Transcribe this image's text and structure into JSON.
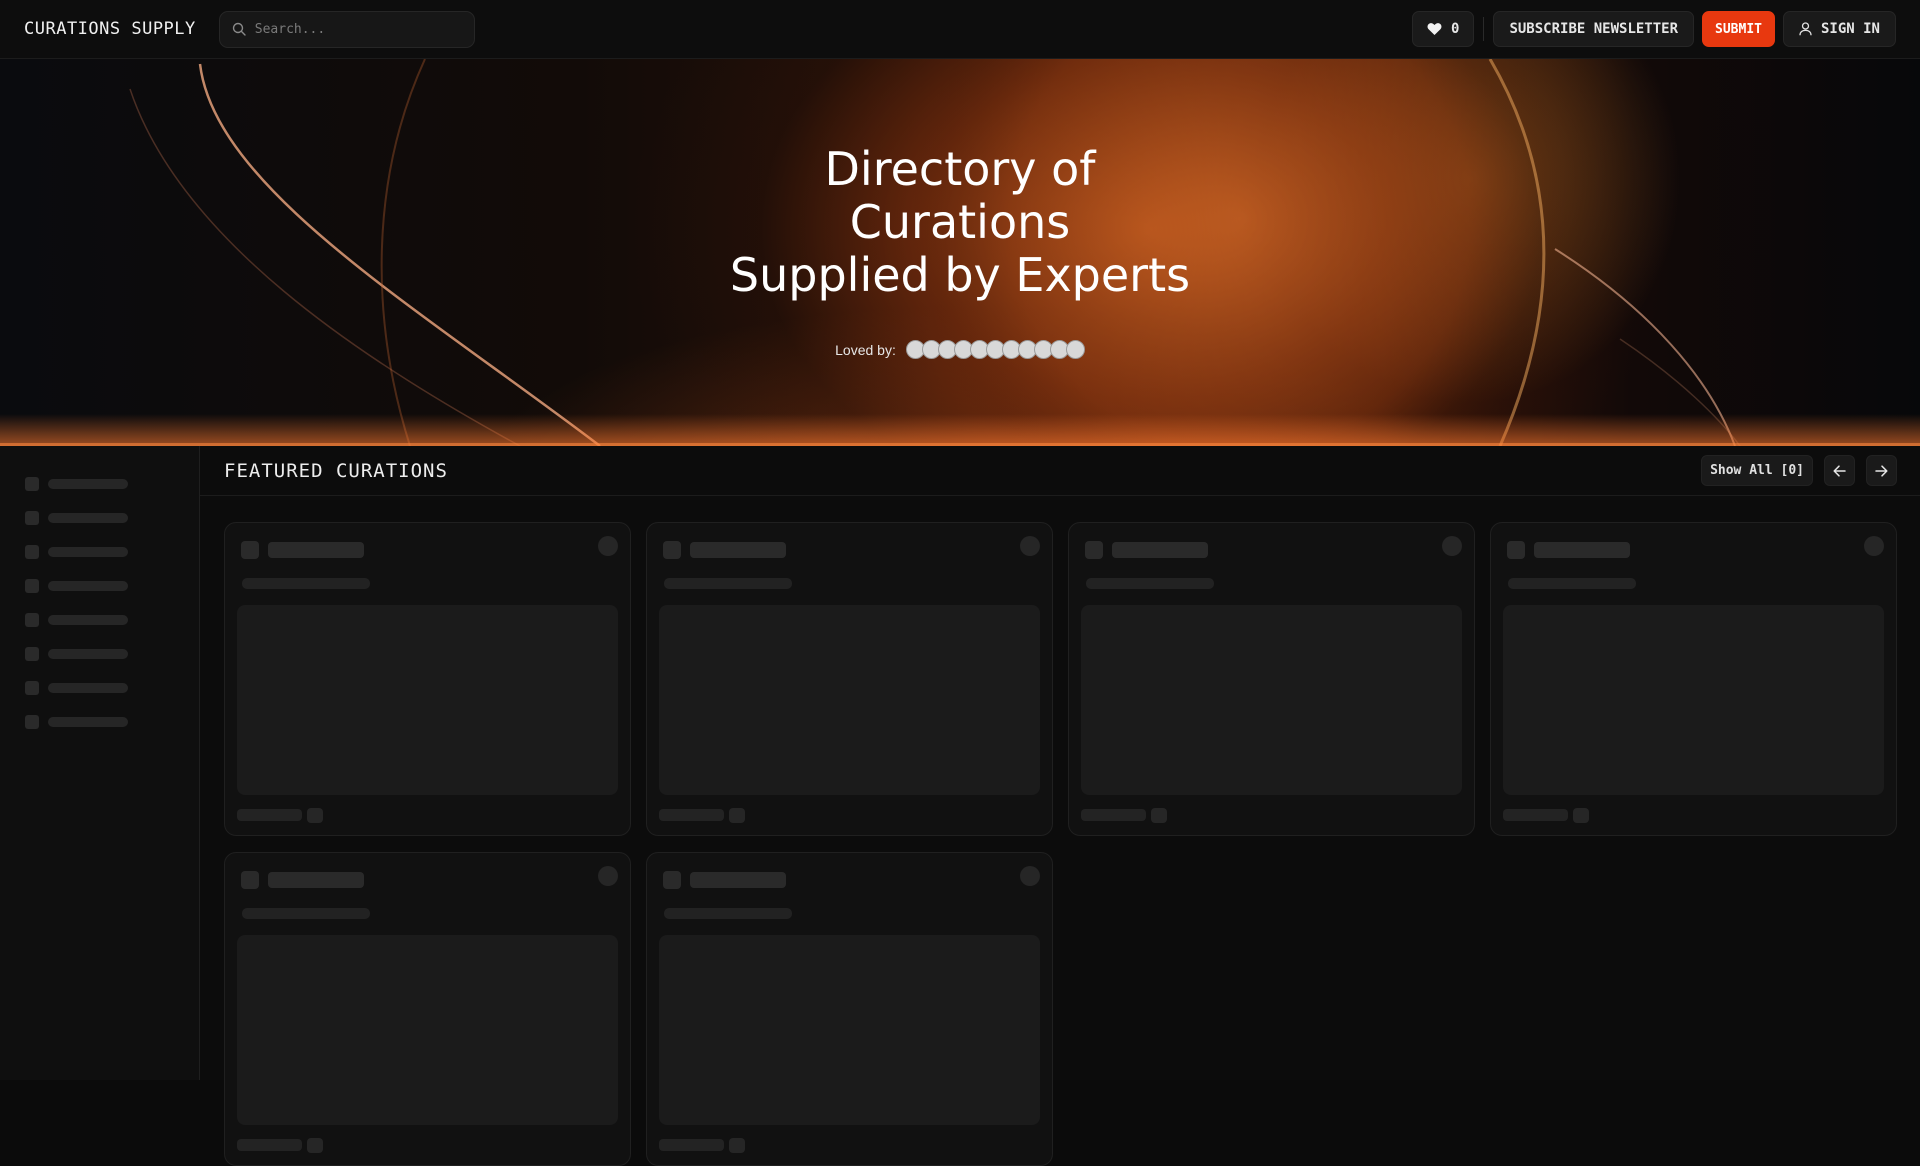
{
  "header": {
    "brand": "CURATIONS SUPPLY",
    "search_placeholder": "Search...",
    "likes_count": "0",
    "subscribe_label": "SUBSCRIBE NEWSLETTER",
    "submit_label": "SUBMIT",
    "signin_label": "SIGN IN"
  },
  "hero": {
    "title_lines": [
      "Directory of",
      "Curations",
      "Supplied by Experts"
    ],
    "loved_by_label": "Loved by:",
    "avatar_count": 11
  },
  "featured": {
    "title": "FEATURED CURATIONS",
    "show_all_label": "Show All [0]"
  },
  "sidebar": {
    "skeleton_items": 8
  },
  "cards": {
    "skeleton_cards": 6
  },
  "colors": {
    "accent": "#e8380f",
    "background": "#0b0b0b",
    "skeleton": "#2a2a2a"
  }
}
